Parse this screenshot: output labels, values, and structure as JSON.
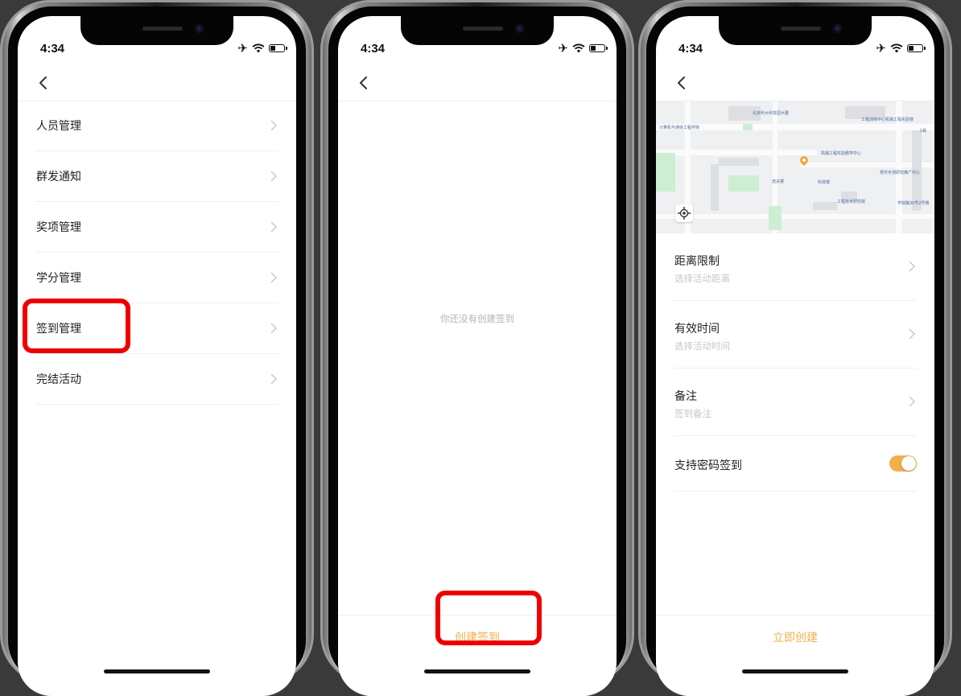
{
  "status_time": "4:34",
  "colors": {
    "accent": "#f2b04b",
    "highlight": "#ee0000",
    "text": "#222222",
    "muted": "#b4b4b4"
  },
  "screen1": {
    "back_icon": "chevron-left-icon",
    "menu": [
      {
        "label": "人员管理"
      },
      {
        "label": "群发通知"
      },
      {
        "label": "奖项管理"
      },
      {
        "label": "学分管理"
      },
      {
        "label": "签到管理"
      },
      {
        "label": "完结活动"
      }
    ],
    "highlighted_item": "签到管理"
  },
  "screen2": {
    "empty_text": "你还没有创建签到",
    "button_label": "创建签到"
  },
  "screen3": {
    "map": {
      "pois": [
        "北京科大科技园大厦",
        "计算机与通信工程学院",
        "工程训练中心机械工程实验楼",
        "机械工程实验教学中心",
        "逸夫楼",
        "科技楼",
        "零件专测研究推广中心",
        "工程技术研究院",
        "学院路30号2号楼",
        "1栋"
      ]
    },
    "rows": [
      {
        "label": "距离限制",
        "placeholder": "选择活动距离"
      },
      {
        "label": "有效时间",
        "placeholder": "选择活动时间"
      },
      {
        "label": "备注",
        "placeholder": "签到备注"
      }
    ],
    "toggle": {
      "label": "支持密码签到",
      "on": true
    },
    "button_label": "立即创建"
  }
}
